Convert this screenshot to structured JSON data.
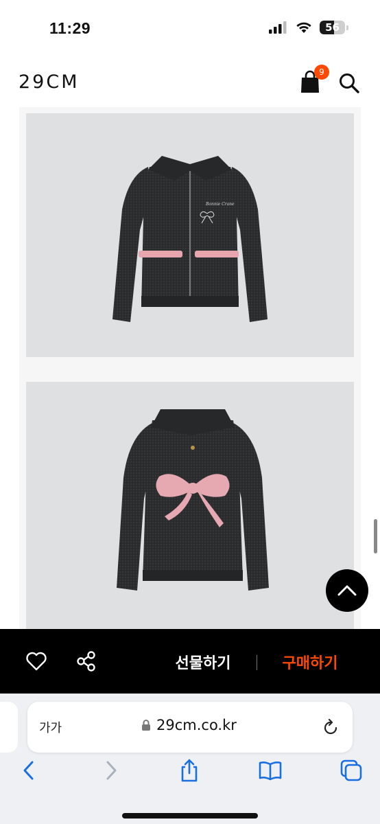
{
  "status_bar": {
    "time": "11:29",
    "battery_level": "56"
  },
  "header": {
    "logo": "29CM",
    "cart_count": "9"
  },
  "product": {
    "images": [
      "front-view-zip-cardigan",
      "back-view-bow-intarsia"
    ]
  },
  "action_bar": {
    "gift_label": "선물하기",
    "buy_label": "구매하기",
    "buy_color": "#ff4800"
  },
  "browser": {
    "text_size_label": "가가",
    "url": "29cm.co.kr"
  },
  "icons": [
    "signal-icon",
    "wifi-icon",
    "battery-icon",
    "shopping-bag-icon",
    "search-icon",
    "heart-icon",
    "share-icon",
    "scroll-to-top-icon",
    "lock-icon",
    "reload-icon",
    "back-icon",
    "forward-icon",
    "share-sheet-icon",
    "bookmarks-icon",
    "tabs-icon"
  ]
}
